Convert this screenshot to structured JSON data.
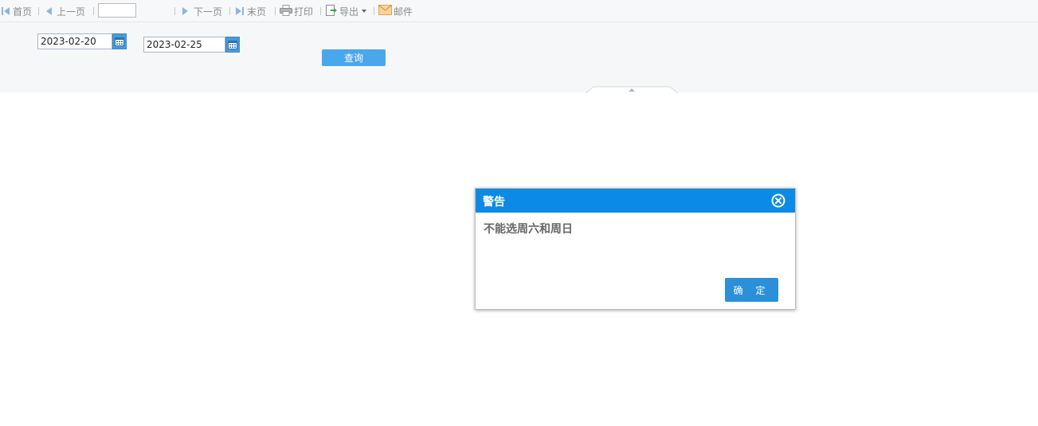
{
  "toolbar": {
    "first_label": "首页",
    "prev_label": "上一页",
    "page_value": "",
    "next_label": "下一页",
    "last_label": "末页",
    "print_label": "打印",
    "export_label": "导出",
    "mail_label": "邮件"
  },
  "params": {
    "start_date": "2023-02-20",
    "end_date": "2023-02-25",
    "query_label": "查询"
  },
  "dialog": {
    "title": "警告",
    "message": "不能选周六和周日",
    "ok_label": "确 定"
  },
  "colors": {
    "accent": "#0b8be5",
    "button": "#4aa7ec",
    "nav_icon": "#8eb6dc"
  }
}
